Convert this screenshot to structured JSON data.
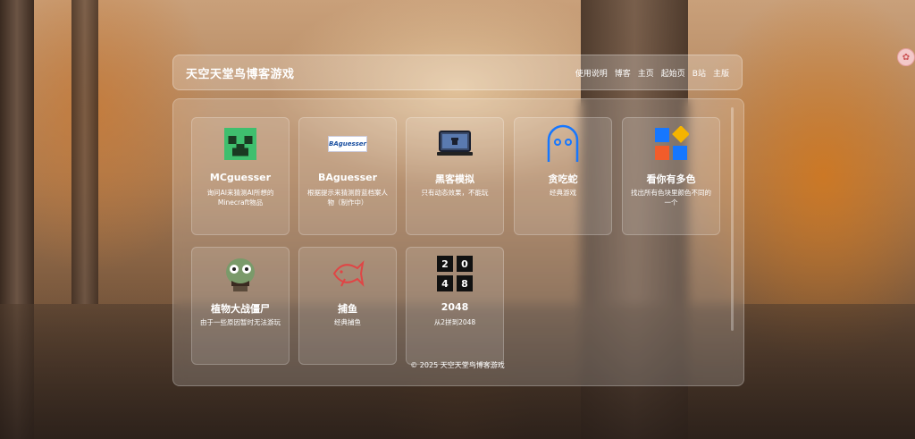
{
  "header": {
    "title": "天空天堂鸟博客游戏",
    "nav": [
      "使用说明",
      "博客",
      "主页",
      "起始页",
      "B站",
      "主版"
    ]
  },
  "games": [
    {
      "title": "MCguesser",
      "desc": "询问AI来猜测AI所想的Minecraft物品",
      "icon": "creeper-icon"
    },
    {
      "title": "BAguesser",
      "desc": "根据提示来猜测蔚蓝档案人物（制作中）",
      "icon": "baguesser-logo",
      "logo_text": "BAguesser"
    },
    {
      "title": "黑客模拟",
      "desc": "只有动态效果，不能玩",
      "icon": "laptop-icon"
    },
    {
      "title": "贪吃蛇",
      "desc": "经典游戏",
      "icon": "ghost-icon"
    },
    {
      "title": "看你有多色",
      "desc": "找出所有色块里颜色不同的一个",
      "icon": "color-blocks-icon"
    },
    {
      "title": "植物大战僵尸",
      "desc": "由于一些原因暂时无法游玩",
      "icon": "zombie-icon"
    },
    {
      "title": "捕鱼",
      "desc": "经典捕鱼",
      "icon": "fish-icon"
    },
    {
      "title": "2048",
      "desc": "从2拼到2048",
      "icon": "tiles-2048-icon",
      "tiles": [
        "2",
        "0",
        "4",
        "8"
      ]
    }
  ],
  "footer": "© 2025 天空天堂鸟博客游戏",
  "colors": {
    "accent": "#1677ff",
    "creeper": "#3fbf6e",
    "fish": "#e04545"
  }
}
